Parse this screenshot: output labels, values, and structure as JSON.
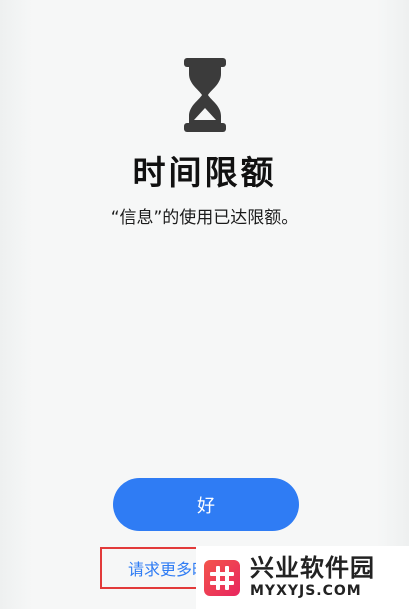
{
  "screen": {
    "title": "时间限额",
    "message": "“信息”的使用已达限额。"
  },
  "actions": {
    "ok_label": "好",
    "request_label": "请求更多时间"
  },
  "watermark": {
    "name_cn": "兴业软件园",
    "domain": "MYXYJS.COM"
  },
  "icons": {
    "hero": "hourglass-icon",
    "watermark_logo": "hash-logo-icon"
  },
  "colors": {
    "accent": "#2f7cf4",
    "hourglass": "#3b3b3b",
    "highlight_box": "#e23a3a",
    "watermark_logo": "#ec3a52"
  }
}
